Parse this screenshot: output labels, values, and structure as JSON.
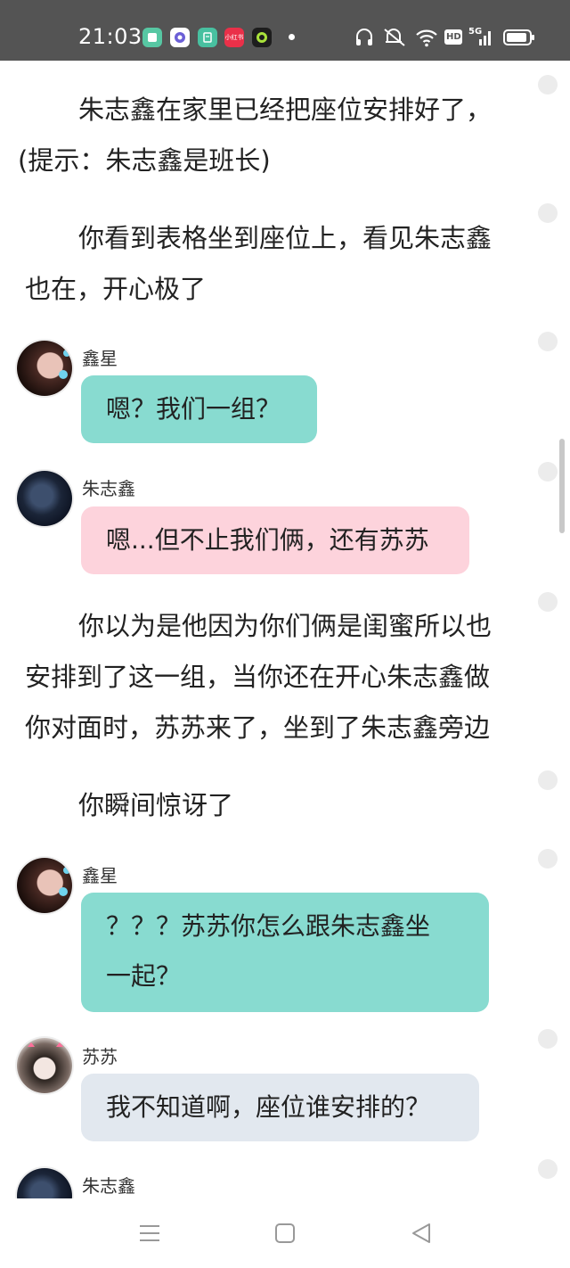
{
  "status_bar": {
    "time": "21:03",
    "app_icons": [
      "app-green-icon",
      "app-purple-icon",
      "app-teal-icon",
      "app-red-icon",
      "app-dark-icon"
    ],
    "app_red_label": "小红书",
    "network": "5G",
    "hd_label": "HD"
  },
  "story": {
    "p1_line1": "朱志鑫在家里已经把座位安排好了，",
    "p1_line2": "(提示：朱志鑫是班长)",
    "p2_line1": "你看到表格坐到座位上，看见朱志鑫",
    "p2_line2": "也在，开心极了",
    "p3_line1": "你以为是他因为你们俩是闺蜜所以也",
    "p3_line2": "安排到了这一组，当你还在开心朱志鑫做",
    "p3_line3": "你对面时，苏苏来了，坐到了朱志鑫旁边",
    "p4_line1": "你瞬间惊讶了"
  },
  "messages": [
    {
      "name": "鑫星",
      "text": "嗯？我们一组？"
    },
    {
      "name": "朱志鑫",
      "text": "嗯...但不止我们俩，还有苏苏"
    },
    {
      "name": "鑫星",
      "text_line1": "？？？苏苏你怎么跟朱志鑫坐",
      "text_line2": "一起？"
    },
    {
      "name": "苏苏",
      "text": "我不知道啊，座位谁安排的？"
    },
    {
      "name": "朱志鑫"
    }
  ],
  "colors": {
    "status_bar_bg": "#545454",
    "bubble_teal": "#88dbd0",
    "bubble_pink": "#fdd3dc",
    "bubble_gray": "#e2e8ef"
  }
}
